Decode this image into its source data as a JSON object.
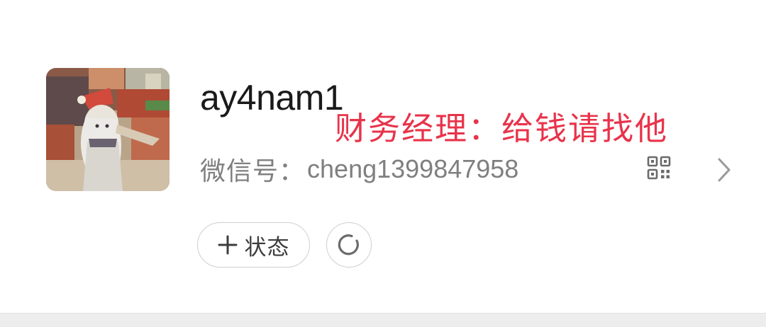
{
  "profile": {
    "nickname": "ay4nam1",
    "wechat_id_label": "微信号",
    "wechat_id_separator": "：",
    "wechat_id": "cheng1399847958",
    "annotation": "财务经理：给钱请找他",
    "avatar_icon": "avatar-illustration",
    "qr_icon": "qr-code-icon",
    "chevron_icon": "chevron-right-icon"
  },
  "actions": {
    "status_label": "状态",
    "status_icon": "plus-icon",
    "refresh_icon": "refresh-icon"
  },
  "colors": {
    "annotation": "#e8334a",
    "nickname": "#1a1a1a",
    "secondary_text": "#7f7f7f",
    "button_border": "#cfcfcf",
    "footer_band": "#ededed"
  }
}
